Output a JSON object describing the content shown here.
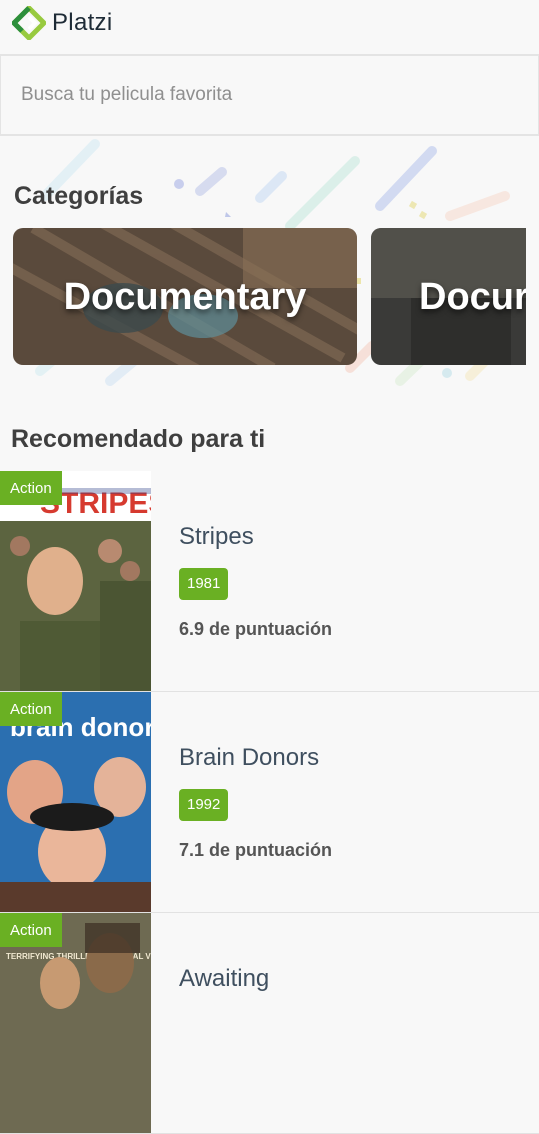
{
  "header": {
    "brand": "Platzi"
  },
  "search": {
    "placeholder": "Busca tu pelicula favorita",
    "value": ""
  },
  "categories": {
    "title": "Categorías",
    "items": [
      {
        "label": "Documentary"
      },
      {
        "label": "Docur"
      }
    ]
  },
  "recommended": {
    "title": "Recomendado para ti",
    "movies": [
      {
        "genre": "Action",
        "title": "Stripes",
        "year": "1981",
        "score": "6.9 de puntuación",
        "poster_text": "STRIPES"
      },
      {
        "genre": "Action",
        "title": "Brain Donors",
        "year": "1992",
        "score": "7.1 de puntuación",
        "poster_text": "brain donors"
      },
      {
        "genre": "Action",
        "title": "Awaiting",
        "year": "",
        "score": "",
        "poster_text": "TERRIFYING THRILLER ESSENTIAL VIEWING"
      }
    ]
  },
  "colors": {
    "accent_green": "#6ab023",
    "background": "#f8f8f8",
    "text_dark": "#3f3f3f"
  }
}
